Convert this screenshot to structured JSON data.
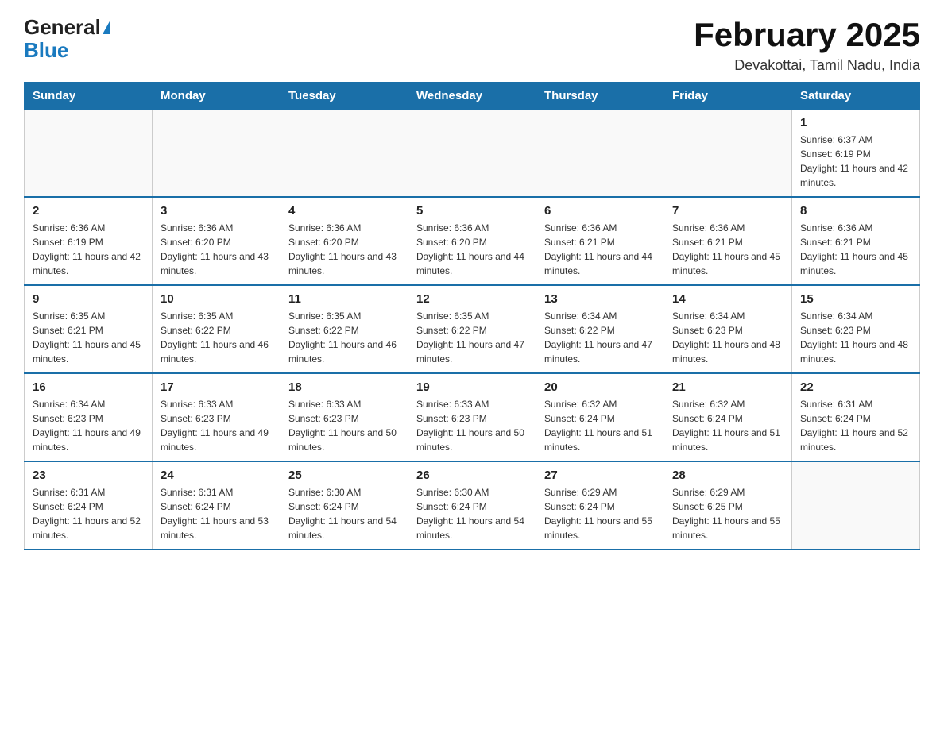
{
  "logo": {
    "general": "General",
    "blue": "Blue"
  },
  "header": {
    "title": "February 2025",
    "subtitle": "Devakottai, Tamil Nadu, India"
  },
  "weekdays": [
    "Sunday",
    "Monday",
    "Tuesday",
    "Wednesday",
    "Thursday",
    "Friday",
    "Saturday"
  ],
  "weeks": [
    [
      {
        "day": "",
        "info": ""
      },
      {
        "day": "",
        "info": ""
      },
      {
        "day": "",
        "info": ""
      },
      {
        "day": "",
        "info": ""
      },
      {
        "day": "",
        "info": ""
      },
      {
        "day": "",
        "info": ""
      },
      {
        "day": "1",
        "info": "Sunrise: 6:37 AM\nSunset: 6:19 PM\nDaylight: 11 hours and 42 minutes."
      }
    ],
    [
      {
        "day": "2",
        "info": "Sunrise: 6:36 AM\nSunset: 6:19 PM\nDaylight: 11 hours and 42 minutes."
      },
      {
        "day": "3",
        "info": "Sunrise: 6:36 AM\nSunset: 6:20 PM\nDaylight: 11 hours and 43 minutes."
      },
      {
        "day": "4",
        "info": "Sunrise: 6:36 AM\nSunset: 6:20 PM\nDaylight: 11 hours and 43 minutes."
      },
      {
        "day": "5",
        "info": "Sunrise: 6:36 AM\nSunset: 6:20 PM\nDaylight: 11 hours and 44 minutes."
      },
      {
        "day": "6",
        "info": "Sunrise: 6:36 AM\nSunset: 6:21 PM\nDaylight: 11 hours and 44 minutes."
      },
      {
        "day": "7",
        "info": "Sunrise: 6:36 AM\nSunset: 6:21 PM\nDaylight: 11 hours and 45 minutes."
      },
      {
        "day": "8",
        "info": "Sunrise: 6:36 AM\nSunset: 6:21 PM\nDaylight: 11 hours and 45 minutes."
      }
    ],
    [
      {
        "day": "9",
        "info": "Sunrise: 6:35 AM\nSunset: 6:21 PM\nDaylight: 11 hours and 45 minutes."
      },
      {
        "day": "10",
        "info": "Sunrise: 6:35 AM\nSunset: 6:22 PM\nDaylight: 11 hours and 46 minutes."
      },
      {
        "day": "11",
        "info": "Sunrise: 6:35 AM\nSunset: 6:22 PM\nDaylight: 11 hours and 46 minutes."
      },
      {
        "day": "12",
        "info": "Sunrise: 6:35 AM\nSunset: 6:22 PM\nDaylight: 11 hours and 47 minutes."
      },
      {
        "day": "13",
        "info": "Sunrise: 6:34 AM\nSunset: 6:22 PM\nDaylight: 11 hours and 47 minutes."
      },
      {
        "day": "14",
        "info": "Sunrise: 6:34 AM\nSunset: 6:23 PM\nDaylight: 11 hours and 48 minutes."
      },
      {
        "day": "15",
        "info": "Sunrise: 6:34 AM\nSunset: 6:23 PM\nDaylight: 11 hours and 48 minutes."
      }
    ],
    [
      {
        "day": "16",
        "info": "Sunrise: 6:34 AM\nSunset: 6:23 PM\nDaylight: 11 hours and 49 minutes."
      },
      {
        "day": "17",
        "info": "Sunrise: 6:33 AM\nSunset: 6:23 PM\nDaylight: 11 hours and 49 minutes."
      },
      {
        "day": "18",
        "info": "Sunrise: 6:33 AM\nSunset: 6:23 PM\nDaylight: 11 hours and 50 minutes."
      },
      {
        "day": "19",
        "info": "Sunrise: 6:33 AM\nSunset: 6:23 PM\nDaylight: 11 hours and 50 minutes."
      },
      {
        "day": "20",
        "info": "Sunrise: 6:32 AM\nSunset: 6:24 PM\nDaylight: 11 hours and 51 minutes."
      },
      {
        "day": "21",
        "info": "Sunrise: 6:32 AM\nSunset: 6:24 PM\nDaylight: 11 hours and 51 minutes."
      },
      {
        "day": "22",
        "info": "Sunrise: 6:31 AM\nSunset: 6:24 PM\nDaylight: 11 hours and 52 minutes."
      }
    ],
    [
      {
        "day": "23",
        "info": "Sunrise: 6:31 AM\nSunset: 6:24 PM\nDaylight: 11 hours and 52 minutes."
      },
      {
        "day": "24",
        "info": "Sunrise: 6:31 AM\nSunset: 6:24 PM\nDaylight: 11 hours and 53 minutes."
      },
      {
        "day": "25",
        "info": "Sunrise: 6:30 AM\nSunset: 6:24 PM\nDaylight: 11 hours and 54 minutes."
      },
      {
        "day": "26",
        "info": "Sunrise: 6:30 AM\nSunset: 6:24 PM\nDaylight: 11 hours and 54 minutes."
      },
      {
        "day": "27",
        "info": "Sunrise: 6:29 AM\nSunset: 6:24 PM\nDaylight: 11 hours and 55 minutes."
      },
      {
        "day": "28",
        "info": "Sunrise: 6:29 AM\nSunset: 6:25 PM\nDaylight: 11 hours and 55 minutes."
      },
      {
        "day": "",
        "info": ""
      }
    ]
  ]
}
